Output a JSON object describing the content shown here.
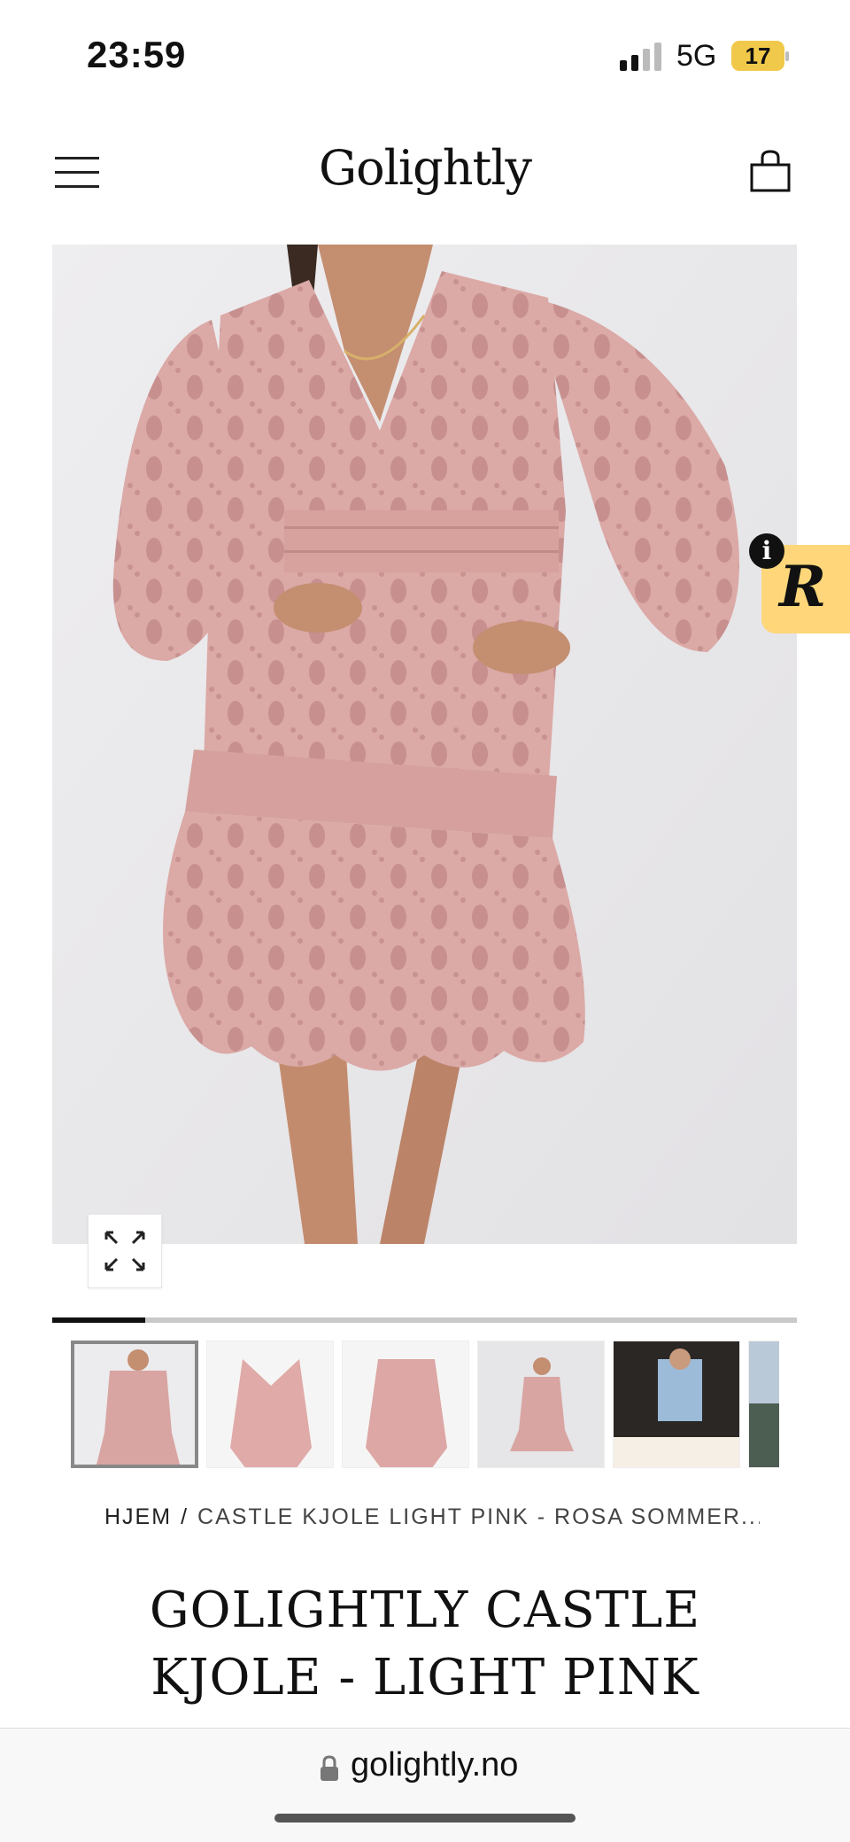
{
  "status_bar": {
    "time": "23:59",
    "network": "5G",
    "battery": "17"
  },
  "header": {
    "logo": "Golightly"
  },
  "gallery": {
    "progress": 0.125,
    "thumbnail_count": 6,
    "active_index": 0
  },
  "breadcrumb": {
    "home": "HJEM",
    "separator": "/",
    "current": "CASTLE KJOLE LIGHT PINK - ROSA SOMMER..."
  },
  "product": {
    "title_line1": "GOLIGHTLY CASTLE",
    "title_line2": "KJOLE - LIGHT PINK"
  },
  "browser": {
    "url": "golightly.no"
  },
  "colors": {
    "accent_badge": "#ffd77a",
    "dress_pink": "#d9a5a3",
    "background": "#ffffff"
  }
}
